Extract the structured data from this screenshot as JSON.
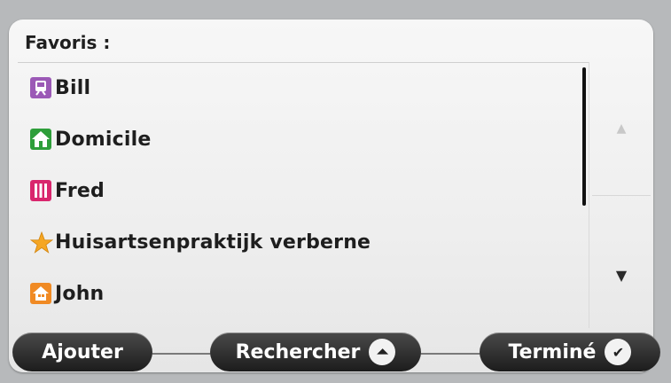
{
  "list": {
    "header": "Favoris :",
    "items": [
      {
        "label": "Bill",
        "icon": "train-station-icon",
        "color": "#9b59b6"
      },
      {
        "label": "Domicile",
        "icon": "home-icon",
        "color": "#2e9e3a"
      },
      {
        "label": "Fred",
        "icon": "bars-icon",
        "color": "#d9266d"
      },
      {
        "label": "Huisartsenpraktijk verberne",
        "icon": "star-icon",
        "color": "#f5a623"
      },
      {
        "label": "John",
        "icon": "house-orange-icon",
        "color": "#f08a24"
      }
    ]
  },
  "scroll": {
    "up_glyph": "▲",
    "down_glyph": "▼"
  },
  "buttons": {
    "add": "Ajouter",
    "search": "Rechercher",
    "search_icon": "⏶",
    "done": "Terminé",
    "done_icon": "✔"
  }
}
